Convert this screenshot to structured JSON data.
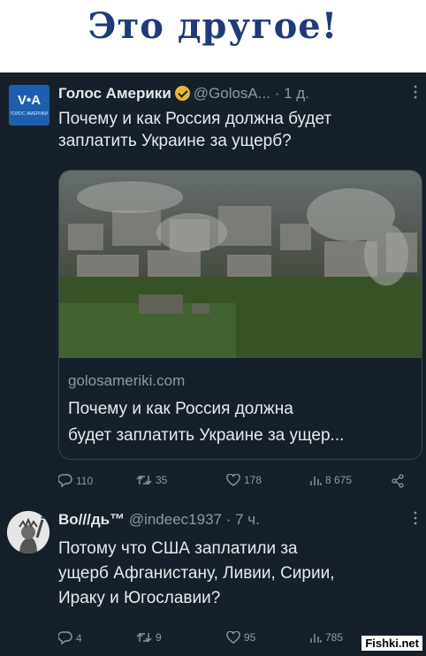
{
  "banner": {
    "title": "Это другое!"
  },
  "tweet1": {
    "avatar_text": "V•A",
    "avatar_subtext": "ГОЛОС АМЕРИКИ",
    "display_name": "Голос Америки",
    "handle": "@GolosA...",
    "sep": "·",
    "time": "1 д.",
    "text_line1": "Почему и как Россия должна будет",
    "text_line2": "заплатить Украине за ущерб?",
    "card": {
      "domain": "golosameriki.com",
      "title_line1": "Почему и как Россия должна",
      "title_line2": "будет заплатить Украине за ущер..."
    },
    "replies": "110",
    "retweets": "35",
    "likes": "178",
    "views": "8 675"
  },
  "tweet2": {
    "display_name": "Во///дь™",
    "handle": "@indeec1937",
    "sep": "·",
    "time": "7 ч.",
    "text_line1": "Потому что США заплатили за",
    "text_line2": "ущерб Афганистану, Ливии, Сирии,",
    "text_line3": "Ираку и Югославии?",
    "replies": "4",
    "retweets": "9",
    "likes": "95",
    "views": "785"
  },
  "watermark": "Fishki.net",
  "icons": {
    "reply": "reply-icon",
    "retweet": "retweet-icon",
    "like": "heart-icon",
    "views": "views-icon",
    "share": "share-icon",
    "more": "more-icon"
  }
}
